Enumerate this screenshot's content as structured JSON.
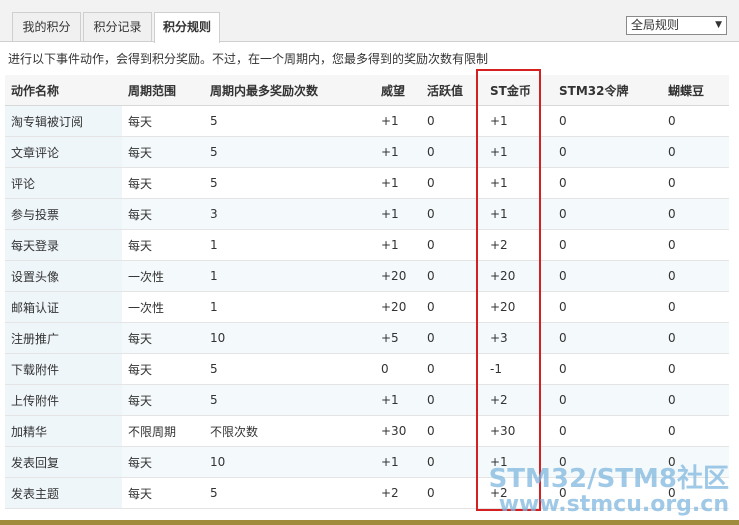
{
  "tabs": [
    {
      "label": "我的积分"
    },
    {
      "label": "积分记录"
    },
    {
      "label": "积分规则",
      "active": true
    }
  ],
  "filter": {
    "value": "全局规则"
  },
  "description": "进行以下事件动作，会得到积分奖励。不过，在一个周期内，您最多得到的奖励次数有限制",
  "table": {
    "headers": [
      "动作名称",
      "周期范围",
      "周期内最多奖励次数",
      "威望",
      "活跃值",
      "ST金币",
      "STM32令牌",
      "蝴蝶豆"
    ],
    "rows": [
      [
        "淘专辑被订阅",
        "每天",
        "5",
        "+1",
        "0",
        "+1",
        "0",
        "0"
      ],
      [
        "文章评论",
        "每天",
        "5",
        "+1",
        "0",
        "+1",
        "0",
        "0"
      ],
      [
        "评论",
        "每天",
        "5",
        "+1",
        "0",
        "+1",
        "0",
        "0"
      ],
      [
        "参与投票",
        "每天",
        "3",
        "+1",
        "0",
        "+1",
        "0",
        "0"
      ],
      [
        "每天登录",
        "每天",
        "1",
        "+1",
        "0",
        "+2",
        "0",
        "0"
      ],
      [
        "设置头像",
        "一次性",
        "1",
        "+20",
        "0",
        "+20",
        "0",
        "0"
      ],
      [
        "邮箱认证",
        "一次性",
        "1",
        "+20",
        "0",
        "+20",
        "0",
        "0"
      ],
      [
        "注册推广",
        "每天",
        "10",
        "+5",
        "0",
        "+3",
        "0",
        "0"
      ],
      [
        "下载附件",
        "每天",
        "5",
        "0",
        "0",
        "-1",
        "0",
        "0"
      ],
      [
        "上传附件",
        "每天",
        "5",
        "+1",
        "0",
        "+2",
        "0",
        "0"
      ],
      [
        "加精华",
        "不限周期",
        "不限次数",
        "+30",
        "0",
        "+30",
        "0",
        "0"
      ],
      [
        "发表回复",
        "每天",
        "10",
        "+1",
        "0",
        "+1",
        "0",
        "0"
      ],
      [
        "发表主题",
        "每天",
        "5",
        "+2",
        "0",
        "+2",
        "0",
        "0"
      ]
    ]
  },
  "watermark": {
    "line1": "STM32/STM8社区",
    "line2": "www.stmcu.org.cn"
  }
}
